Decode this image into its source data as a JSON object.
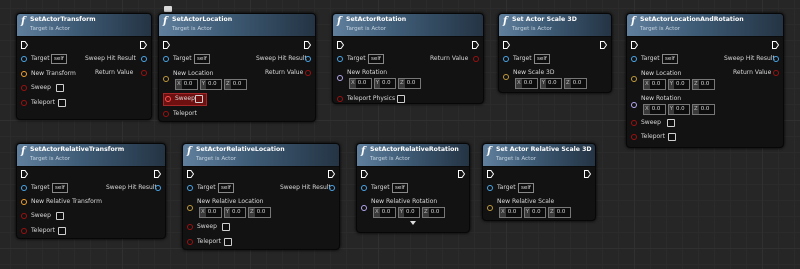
{
  "common": {
    "func_icon": "f",
    "subtitle": "Target is Actor",
    "self": "self",
    "target": "Target",
    "sweep": "Sweep",
    "teleport": "Teleport",
    "sweep_hit": "Sweep Hit Result",
    "return_value": "Return Value",
    "zero": "0.0",
    "x": "X",
    "y": "Y",
    "z": "Z"
  },
  "nodes": {
    "n1": {
      "title": "SetActorTransform",
      "new_label": "New Transform"
    },
    "n2": {
      "title": "SetActorLocation",
      "new_label": "New Location"
    },
    "n3": {
      "title": "SetActorRotation",
      "new_label": "New Rotation",
      "teleport_physics": "Teleport Physics"
    },
    "n4": {
      "title": "Set Actor Scale 3D",
      "new_label": "New Scale 3D"
    },
    "n5": {
      "title": "SetActorLocationAndRotation",
      "new_loc": "New Location",
      "new_rot": "New Rotation"
    },
    "n6": {
      "title": "SetActorRelativeTransform",
      "new_label": "New Relative Transform"
    },
    "n7": {
      "title": "SetActorRelativeLocation",
      "new_label": "New Relative Location"
    },
    "n8": {
      "title": "SetActorRelativeRotation",
      "new_label": "New Relative Rotation"
    },
    "n9": {
      "title": "Set Actor Relative Scale 3D",
      "new_label": "New Relative Scale"
    }
  },
  "colors": {
    "header": "#3d5a74",
    "exec": "#ffffff",
    "object_pin": "#4aa6e8",
    "transform_pin": "#f0a02c",
    "rotator_pin": "#b4a6ec",
    "bool_pin": "#9c1111",
    "vector_pin": "#c09a3a",
    "sweep_highlight": "#6e1010"
  }
}
